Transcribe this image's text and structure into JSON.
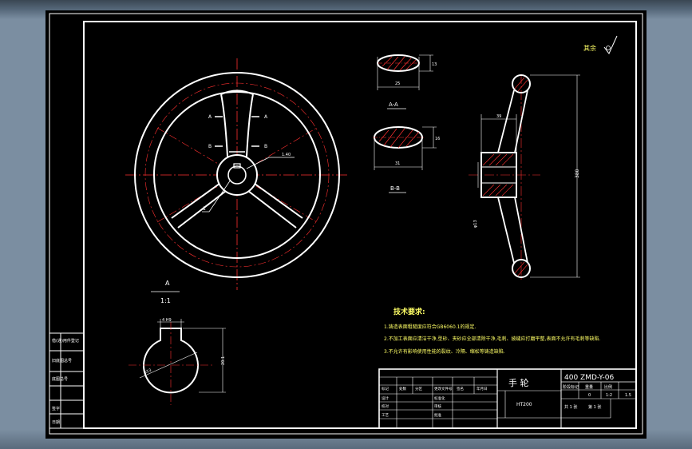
{
  "view_labels": {
    "section_aa": "A-A",
    "section_bb": "B-B",
    "detail_letter": "A",
    "detail_scale": "1:1"
  },
  "dimensions": {
    "aa_height": "13",
    "aa_width": "25",
    "bb_height": "16",
    "bb_width": "31",
    "side_offset": "39",
    "side_height": "380",
    "hub_bore": "φ13",
    "key_label": "1.40",
    "detail_key_width": "4 H9",
    "detail_bore": "φ13",
    "detail_depth": "20.1",
    "section_mark_a": "A",
    "section_mark_b": "B",
    "leader_num": "1",
    "surface_note": "其余",
    "roughness": "6.3"
  },
  "tech_requirements": {
    "title": "技术要求:",
    "items": [
      "1.铸造表面粗糙度应符合GB6060.1的规定.",
      "2.不加工表面应清洁干净,型砂、夹砂应全部清除干净,毛刺、披缝应打磨平整,表面不允许有毛刺等缺陷.",
      "3.不允许有影响使用性能的裂纹、冷隔、缩松等铸造缺陷."
    ]
  },
  "title_block": {
    "part_name": "手 轮",
    "drawing_no": "400 ZMD-Y-06",
    "material": "HT200",
    "col_stage": "阶段标记",
    "col_weight": "重量",
    "col_scale": "比例",
    "weight": "0",
    "scale": "1:2",
    "scale2": "1.5",
    "sheets_total": "共 1 张",
    "sheet_no": "第 1 张",
    "row_labels": [
      "标记",
      "处数",
      "分区",
      "更改文件号",
      "签名",
      "年月日"
    ],
    "roles": [
      "设计",
      "标准化",
      "校对",
      "审核",
      "工艺",
      "批准"
    ]
  },
  "side_table": {
    "rows": [
      "借(通)用件登记",
      "旧底图总号",
      "底图总号",
      "签字",
      "日期"
    ]
  }
}
